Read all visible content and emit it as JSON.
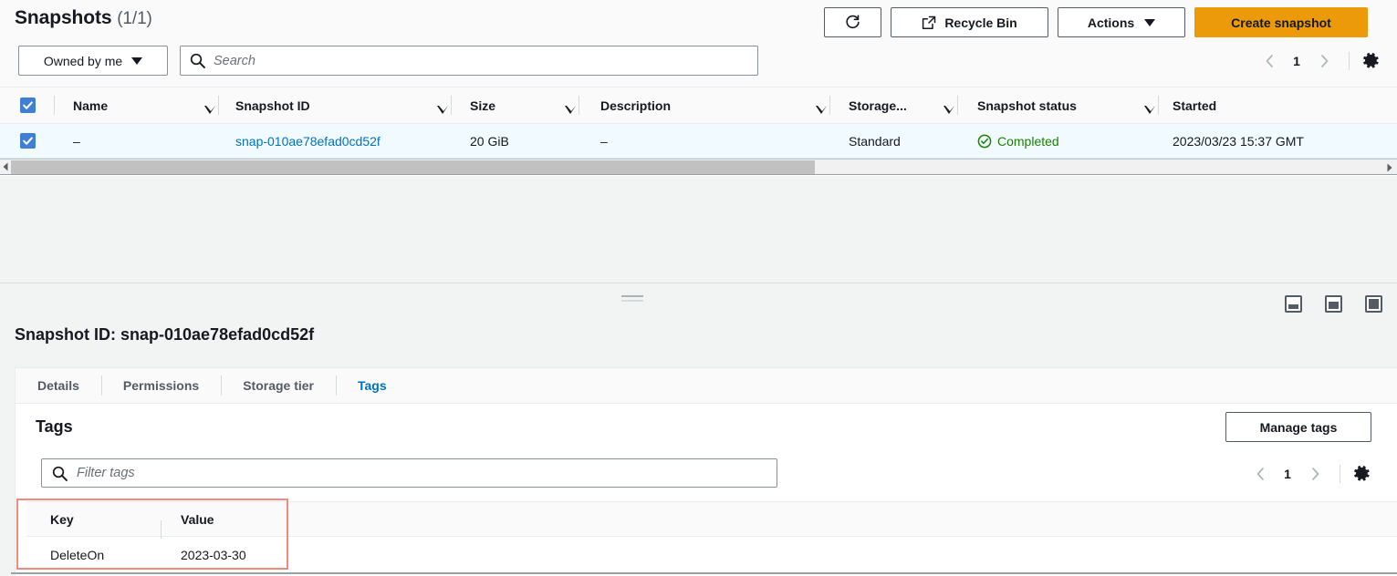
{
  "list": {
    "title": "Snapshots",
    "count": "(1/1)",
    "owner_filter": {
      "label": "Owned by me",
      "icon": "chevron-down-icon"
    },
    "search": {
      "placeholder": "Search",
      "value": "",
      "icon": "search-icon"
    },
    "buttons": {
      "refresh_label": "",
      "refresh_icon": "refresh-icon",
      "recycle_bin_label": "Recycle Bin",
      "recycle_bin_icon": "external-link-icon",
      "actions_label": "Actions",
      "actions_icon": "chevron-down-icon",
      "create_snapshot_label": "Create snapshot"
    },
    "pagination": {
      "prev_icon": "chevron-left-icon",
      "page": "1",
      "next_icon": "chevron-right-icon",
      "settings_icon": "gear-icon"
    },
    "columns": [
      {
        "label": "Name",
        "sortable": true
      },
      {
        "label": "Snapshot ID",
        "sortable": true
      },
      {
        "label": "Size",
        "sortable": true
      },
      {
        "label": "Description",
        "sortable": true
      },
      {
        "label": "Storage...",
        "sortable": true
      },
      {
        "label": "Snapshot status",
        "sortable": true
      },
      {
        "label": "Started",
        "sortable": false
      }
    ],
    "rows": [
      {
        "selected": true,
        "name": "–",
        "snapshot_id": "snap-010ae78efad0cd52f",
        "size": "20 GiB",
        "description": "–",
        "storage_tier": "Standard",
        "status": "Completed",
        "status_icon": "check-circle-icon",
        "started": "2023/03/23 15:37 GMT"
      }
    ],
    "select_all_checked": true,
    "scrollbar": {
      "left_arrow_icon": "arrow-left-icon",
      "right_arrow_icon": "arrow-right-icon"
    }
  },
  "detail": {
    "drag_handle_name": "panel-resize-handle",
    "panel_size_icons": [
      "panel-size-small-icon",
      "panel-size-medium-icon",
      "panel-size-large-icon"
    ],
    "heading": "Snapshot ID: snap-010ae78efad0cd52f",
    "tabs": [
      {
        "label": "Details",
        "active": false
      },
      {
        "label": "Permissions",
        "active": false
      },
      {
        "label": "Storage tier",
        "active": false
      },
      {
        "label": "Tags",
        "active": true
      }
    ],
    "tags": {
      "title": "Tags",
      "manage_label": "Manage tags",
      "filter": {
        "placeholder": "Filter tags",
        "value": "",
        "icon": "search-icon"
      },
      "pagination": {
        "prev_icon": "chevron-left-icon",
        "page": "1",
        "next_icon": "chevron-right-icon",
        "settings_icon": "gear-icon"
      },
      "columns": [
        "Key",
        "Value"
      ],
      "rows": [
        {
          "key": "DeleteOn",
          "value": "2023-03-30"
        }
      ],
      "highlight_color": "#f08a7e"
    }
  }
}
